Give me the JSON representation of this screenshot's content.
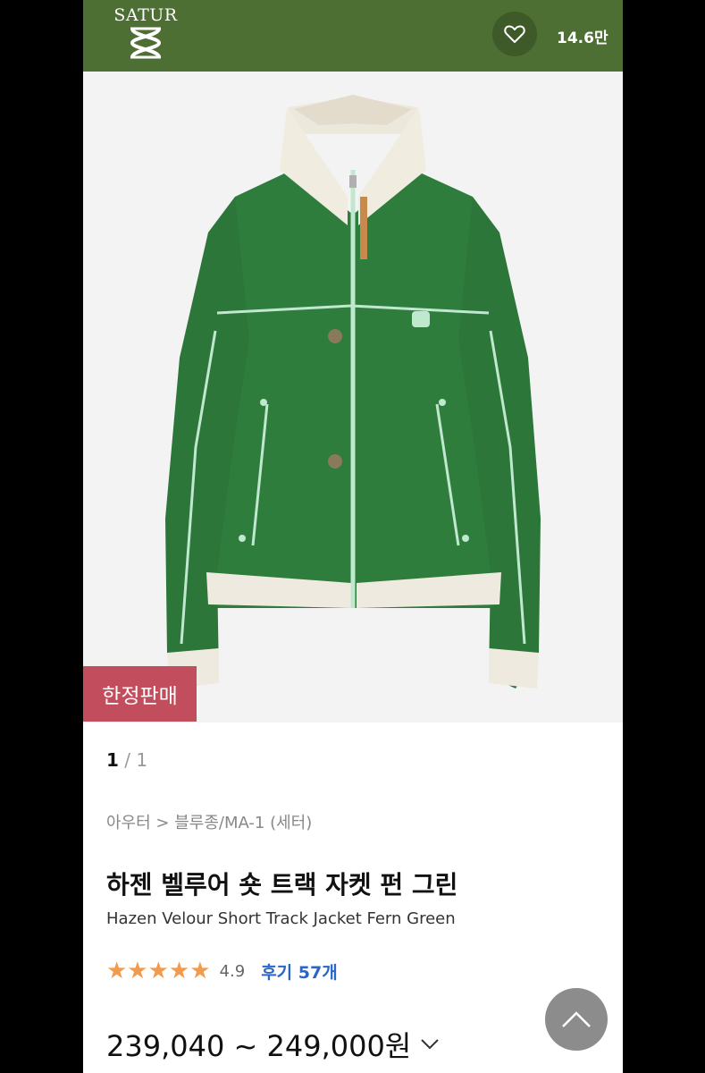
{
  "header": {
    "brand": "SATUR",
    "wish_count": "14.6만"
  },
  "gallery": {
    "badge": "한정판매",
    "current_page": "1",
    "separator": "/",
    "total_pages": "1"
  },
  "product": {
    "breadcrumb": "아우터 > 블루종/MA-1 (세터)",
    "title_ko": "하젠 벨루어 숏 트랙 자켓 펀 그린",
    "title_en": "Hazen Velour Short Track Jacket Fern Green",
    "rating": 4.9,
    "rating_text": "4.9",
    "stars_glyphs": "★★★★★",
    "review_label": "후기 57개",
    "price_range": "239,040 ~ 249,000원"
  },
  "colors": {
    "header_bg": "#4d6f33",
    "jacket": "#2f7d3c",
    "badge": "#c24d5c",
    "stars": "#f29a4e",
    "review_link": "#2a66c8"
  },
  "icons": {
    "wish": "heart-icon",
    "price_toggle": "chevron-down-icon",
    "scroll_top": "chevron-up-icon"
  }
}
